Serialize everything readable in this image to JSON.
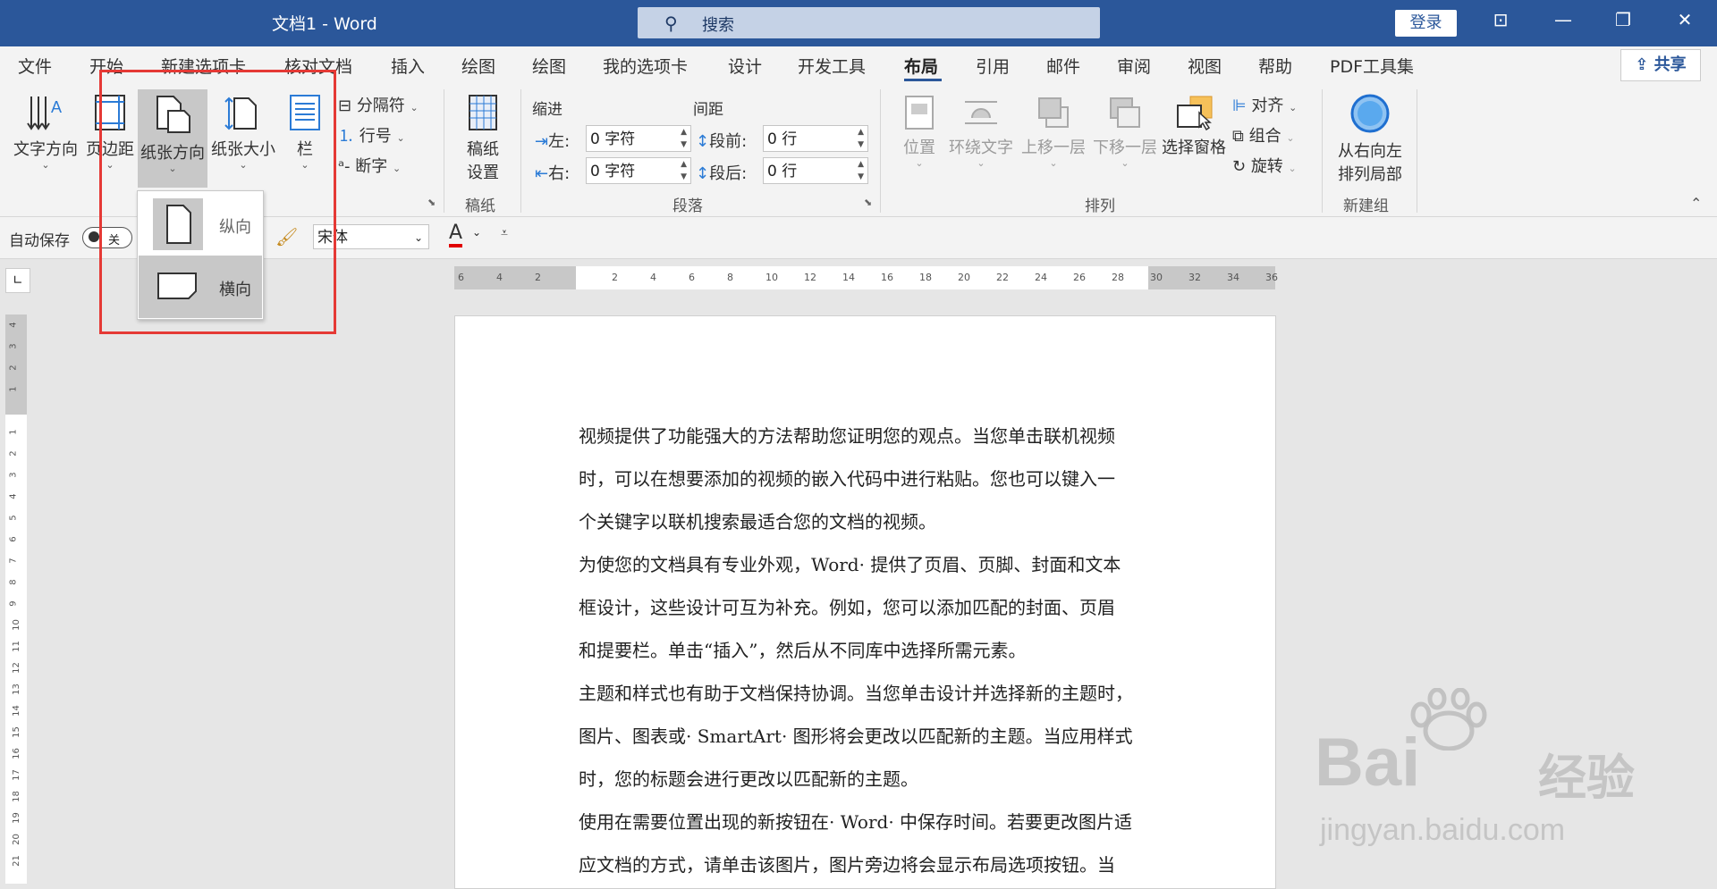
{
  "titlebar": {
    "title": "文档1  -  Word",
    "search_placeholder": "搜索",
    "login": "登录",
    "controls": {
      "ribbon_display": "⊡",
      "minimize": "—",
      "restore": "❐",
      "close": "✕"
    }
  },
  "tabs": [
    "文件",
    "开始",
    "新建选项卡",
    "核对文档",
    "插入",
    "绘图",
    "绘图",
    "我的选项卡",
    "设计",
    "开发工具",
    "布局",
    "引用",
    "邮件",
    "审阅",
    "视图",
    "帮助",
    "PDF工具集"
  ],
  "active_tab": "布局",
  "share": "共享",
  "ribbon": {
    "page_setup": {
      "text_direction": "文字方向",
      "margins": "页边距",
      "orientation": "纸张方向",
      "size": "纸张大小",
      "columns": "栏",
      "breaks": "分隔符",
      "line_numbers": "行号",
      "hyphenation": "断字"
    },
    "manuscript": {
      "settings_line1": "稿纸",
      "settings_line2": "设置",
      "group": "稿纸"
    },
    "paragraph": {
      "indent_title": "缩进",
      "spacing_title": "间距",
      "left_label": "左:",
      "left_value": "0 字符",
      "right_label": "右:",
      "right_value": "0 字符",
      "before_label": "段前:",
      "before_value": "0 行",
      "after_label": "段后:",
      "after_value": "0 行",
      "group": "段落"
    },
    "arrange": {
      "position": "位置",
      "wrap_text": "环绕文字",
      "bring_forward": "上移一层",
      "send_backward": "下移一层",
      "selection_pane": "选择窗格",
      "align": "对齐",
      "group_cmd": "组合",
      "rotate": "旋转",
      "group": "排列"
    },
    "new_group": {
      "rtl_line1": "从右向左",
      "rtl_line2": "排列局部",
      "group": "新建组"
    }
  },
  "qat": {
    "autosave": "自动保存",
    "toggle": "关",
    "font": "宋体",
    "font_color_letter": "A"
  },
  "orientation_menu": {
    "portrait": "纵向",
    "landscape": "横向"
  },
  "ruler": {
    "h_labels": [
      "6",
      "4",
      "2",
      "",
      "2",
      "4",
      "6",
      "8",
      "10",
      "12",
      "14",
      "16",
      "18",
      "20",
      "22",
      "24",
      "26",
      "28",
      "30",
      "32",
      "34",
      "36"
    ],
    "v_labels": [
      "4",
      "3",
      "2",
      "1",
      "",
      "1",
      "2",
      "3",
      "4",
      "5",
      "6",
      "7",
      "8",
      "9",
      "10",
      "11",
      "12",
      "13",
      "14",
      "15",
      "16",
      "17",
      "18",
      "19",
      "20",
      "21"
    ]
  },
  "document": {
    "paragraphs": [
      "视频提供了功能强大的方法帮助您证明您的观点。当您单击联机视频",
      "时，可以在想要添加的视频的嵌入代码中进行粘贴。您也可以键入一",
      "个关键字以联机搜索最适合您的文档的视频。",
      "为使您的文档具有专业外观，Word· 提供了页眉、页脚、封面和文本",
      "框设计，这些设计可互为补充。例如，您可以添加匹配的封面、页眉",
      "和提要栏。单击“插入”，然后从不同库中选择所需元素。",
      "主题和样式也有助于文档保持协调。当您单击设计并选择新的主题时，",
      "图片、图表或· SmartArt· 图形将会更改以匹配新的主题。当应用样式",
      "时，您的标题会进行更改以匹配新的主题。",
      "使用在需要位置出现的新按钮在· Word· 中保存时间。若要更改图片适",
      "应文档的方式，请单击该图片，图片旁边将会显示布局选项按钮。当"
    ]
  },
  "watermark": {
    "brand": "Bai",
    "brand_cn": "经验",
    "url": "jingyan.baidu.com"
  },
  "colors": {
    "title_bar": "#2b579a",
    "highlight_box": "#e53935",
    "font_color_bar": "#e00000"
  }
}
